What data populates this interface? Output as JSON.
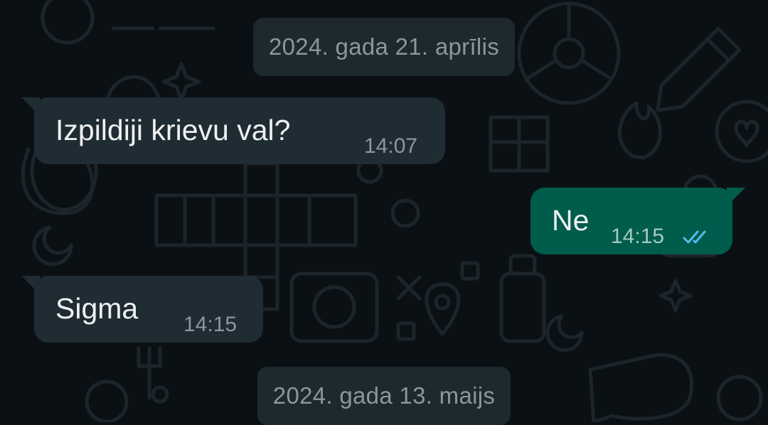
{
  "chat": {
    "date_separators": [
      {
        "label": "2024. gada 21. aprīlis"
      },
      {
        "label": "2024. gada 13. maijs"
      }
    ],
    "messages": [
      {
        "direction": "incoming",
        "text": "Izpildiji krievu val?",
        "time": "14:07"
      },
      {
        "direction": "outgoing",
        "text": "Ne",
        "time": "14:15",
        "status": "read",
        "status_icon": "double-check-icon"
      },
      {
        "direction": "incoming",
        "text": "Sigma",
        "time": "14:15"
      }
    ]
  },
  "colors": {
    "background": "#0b1014",
    "doodle": "#1a2226",
    "incoming_bubble": "#202c33",
    "outgoing_bubble": "#005c4b",
    "date_chip": "#1d282f",
    "read_ticks": "#53bdeb"
  }
}
